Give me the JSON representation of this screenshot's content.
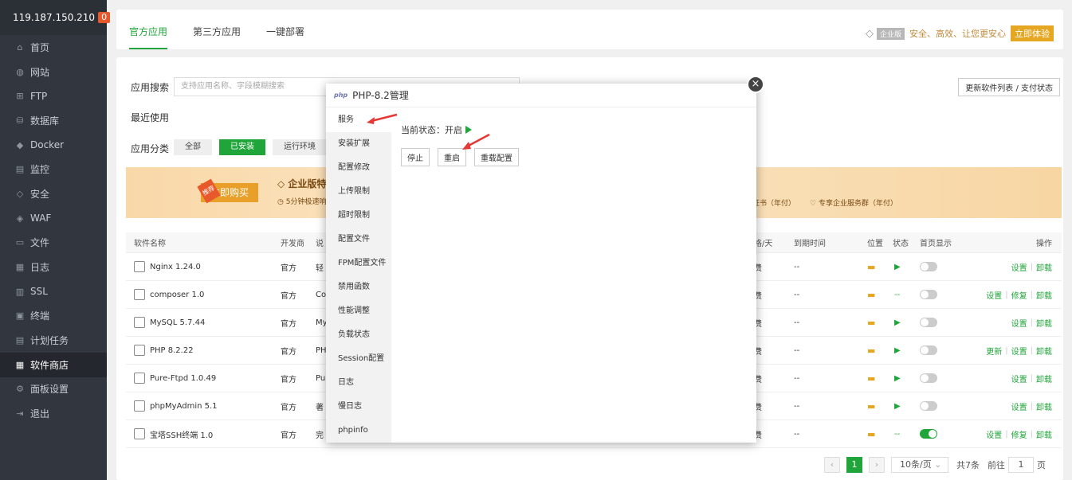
{
  "server": {
    "ip": "119.187.150.210",
    "badge": "0"
  },
  "sidebar": {
    "items": [
      {
        "label": "首页",
        "icon": "home-icon",
        "glyph": "⌂"
      },
      {
        "label": "网站",
        "icon": "globe-icon",
        "glyph": "◍"
      },
      {
        "label": "FTP",
        "icon": "ftp-icon",
        "glyph": "⊞"
      },
      {
        "label": "数据库",
        "icon": "database-icon",
        "glyph": "⛁"
      },
      {
        "label": "Docker",
        "icon": "docker-icon",
        "glyph": "◆"
      },
      {
        "label": "监控",
        "icon": "monitor-icon",
        "glyph": "▤"
      },
      {
        "label": "安全",
        "icon": "shield-icon",
        "glyph": "◇"
      },
      {
        "label": "WAF",
        "icon": "waf-icon",
        "glyph": "◈"
      },
      {
        "label": "文件",
        "icon": "folder-icon",
        "glyph": "▭"
      },
      {
        "label": "日志",
        "icon": "log-icon",
        "glyph": "▦"
      },
      {
        "label": "SSL",
        "icon": "ssl-icon",
        "glyph": "▥"
      },
      {
        "label": "终端",
        "icon": "terminal-icon",
        "glyph": "▣"
      },
      {
        "label": "计划任务",
        "icon": "schedule-icon",
        "glyph": "▤"
      },
      {
        "label": "软件商店",
        "icon": "store-icon",
        "glyph": "▦",
        "active": true
      },
      {
        "label": "面板设置",
        "icon": "settings-icon",
        "glyph": "⚙"
      },
      {
        "label": "退出",
        "icon": "logout-icon",
        "glyph": "⇥"
      }
    ]
  },
  "tabs": [
    "官方应用",
    "第三方应用",
    "一键部署"
  ],
  "enterprise": {
    "badge": "企业版",
    "slogan": "安全、高效、让您更安心",
    "trial": "立即体验"
  },
  "search": {
    "label": "应用搜索",
    "placeholder": "支持应用名称、字段模糊搜索"
  },
  "update_button": "更新软件列表 / 支付状态",
  "recent_label": "最近使用",
  "category": {
    "label": "应用分类",
    "items": [
      "全部",
      "已安装",
      "运行环境"
    ]
  },
  "banner": {
    "buy": "立即购买",
    "tag": "推荐",
    "title": "企业版特",
    "sub": "5分钟极速响",
    "r1": "证书（年付）",
    "r2": "专享企业服务群（年付）"
  },
  "table": {
    "headers": {
      "name": "软件名称",
      "dev": "开发商",
      "desc": "说",
      "price": "价格/天",
      "expire": "到期时间",
      "pos": "位置",
      "status": "状态",
      "home": "首页显示",
      "ops": "操作"
    },
    "rows": [
      {
        "name": "Nginx 1.24.0",
        "icon": "nginx-icon",
        "dev": "官方",
        "desc": "轻",
        "price": "免费",
        "expire": "--",
        "status": "▶",
        "home": false,
        "ops": [
          "设置",
          "卸载"
        ]
      },
      {
        "name": "composer 1.0",
        "icon": "composer-icon",
        "dev": "官方",
        "desc": "Co",
        "price": "免费",
        "expire": "--",
        "status": "--",
        "home": false,
        "ops": [
          "设置",
          "修复",
          "卸载"
        ]
      },
      {
        "name": "MySQL 5.7.44",
        "icon": "mysql-icon",
        "dev": "官方",
        "desc": "My",
        "price": "免费",
        "expire": "--",
        "status": "▶",
        "home": false,
        "ops": [
          "设置",
          "卸载"
        ]
      },
      {
        "name": "PHP 8.2.22",
        "icon": "php-icon",
        "dev": "官方",
        "desc": "PH",
        "price": "免费",
        "expire": "--",
        "status": "▶",
        "home": false,
        "ops": [
          "更新",
          "设置",
          "卸载"
        ]
      },
      {
        "name": "Pure-Ftpd 1.0.49",
        "icon": "ftp-app-icon",
        "dev": "官方",
        "desc": "Pu",
        "price": "免费",
        "expire": "--",
        "status": "▶",
        "home": false,
        "ops": [
          "设置",
          "卸载"
        ]
      },
      {
        "name": "phpMyAdmin 5.1",
        "icon": "phpmyadmin-icon",
        "dev": "官方",
        "desc": "著",
        "price": "免费",
        "expire": "--",
        "status": "▶",
        "home": false,
        "ops": [
          "设置",
          "卸载"
        ]
      },
      {
        "name": "宝塔SSH终端 1.0",
        "icon": "ssh-terminal-icon",
        "dev": "官方",
        "desc": "完",
        "price": "免费",
        "expire": "--",
        "status": "--",
        "home": true,
        "ops": [
          "设置",
          "修复",
          "卸载"
        ]
      }
    ]
  },
  "pager": {
    "current": "1",
    "per_page": "10条/页",
    "total": "共7条",
    "goto": "前往",
    "page_input": "1",
    "page_suffix": "页"
  },
  "modal": {
    "title": "PHP-8.2管理",
    "logo": "php",
    "close": "×",
    "menu": [
      "服务",
      "安装扩展",
      "配置修改",
      "上传限制",
      "超时限制",
      "配置文件",
      "FPM配置文件",
      "禁用函数",
      "性能调整",
      "负载状态",
      "Session配置",
      "日志",
      "慢日志",
      "phpinfo"
    ],
    "status_label": "当前状态：开启",
    "buttons": {
      "stop": "停止",
      "restart": "重启",
      "reload": "重载配置"
    }
  }
}
